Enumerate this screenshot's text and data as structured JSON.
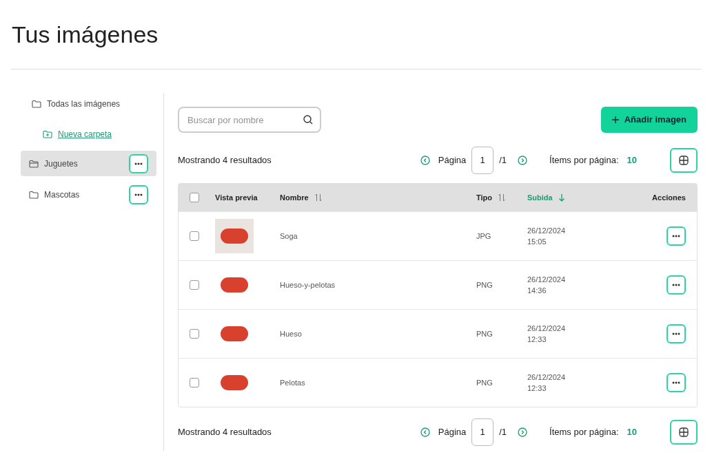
{
  "title": "Tus imágenes",
  "sidebar": {
    "all_label": "Todas las imágenes",
    "new_folder": "Nueva carpeta",
    "folders": [
      {
        "name": "Juguetes",
        "selected": true
      },
      {
        "name": "Mascotas",
        "selected": false
      }
    ]
  },
  "search": {
    "placeholder": "Buscar por nombre"
  },
  "add_button": "Añadir imagen",
  "pagination_top": {
    "results": "Mostrando 4 resultados",
    "page_label": "Página",
    "page": "1",
    "total": "/1",
    "per_page_label": "Ítems por página:",
    "per_page": "10"
  },
  "table": {
    "columns": [
      {
        "label": "Vista previa",
        "kind": "plain"
      },
      {
        "label": "Nombre",
        "kind": "sortable"
      },
      {
        "label": "Tipo",
        "kind": "sortable"
      },
      {
        "label": "Subida",
        "kind": "sorted"
      },
      {
        "label": "Acciones",
        "kind": "plain"
      }
    ],
    "header_checked": false,
    "rows": [
      {
        "checked": false,
        "name": "Soga",
        "type": "JPG",
        "date": "26/12/2024",
        "time": "15:05"
      },
      {
        "checked": false,
        "name": "Hueso-y-pelotas",
        "type": "PNG",
        "date": "26/12/2024",
        "time": "14:36"
      },
      {
        "checked": false,
        "name": "Hueso",
        "type": "PNG",
        "date": "26/12/2024",
        "time": "12:33"
      },
      {
        "checked": false,
        "name": "Pelotas",
        "type": "PNG",
        "date": "26/12/2024",
        "time": "12:33"
      }
    ]
  },
  "pagination_bottom": {
    "results": "Mostrando 4 resultados",
    "page_label": "Página",
    "page": "1",
    "total": "/1",
    "per_page_label": "Ítems por página:",
    "per_page": "10"
  }
}
